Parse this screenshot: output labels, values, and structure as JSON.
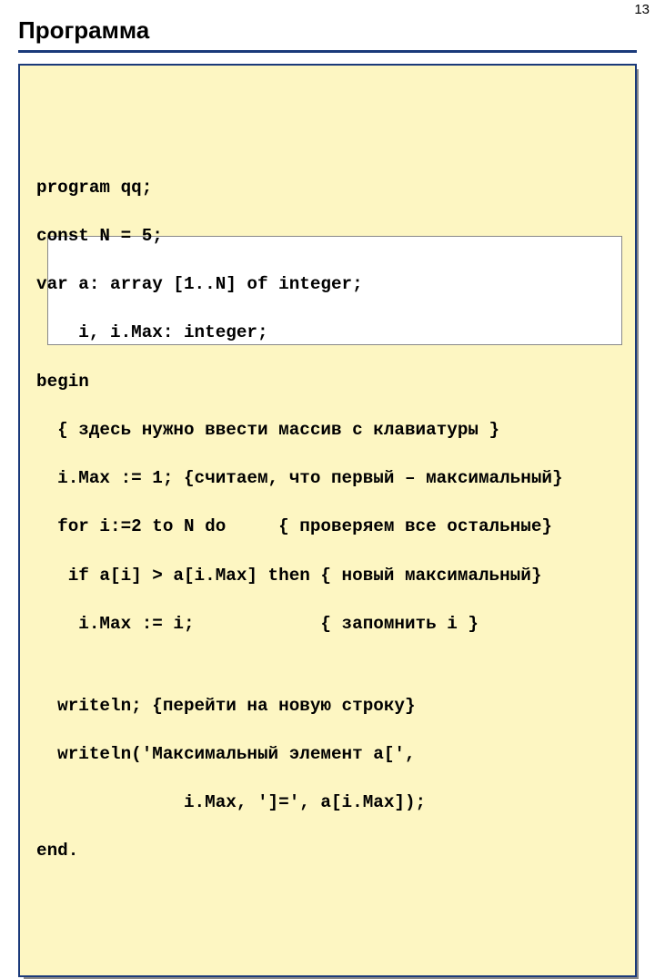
{
  "page_number": "13",
  "title": "Программа",
  "code": {
    "l1": "program qq;",
    "l2": "const N = 5;",
    "l3": "var a: array [1..N] of integer;",
    "l4": "    i, i.Max: integer;",
    "l5": "begin",
    "l6": "  { здесь нужно ввести массив с клавиатуры }",
    "l7": "  i.Max := 1; {считаем, что первый – максимальный}",
    "l8": "  for i:=2 to N do     { проверяем все остальные}",
    "l9": "   if a[i] > a[i.Max] then { новый максимальный}",
    "l10": "    i.Max := i;            { запомнить i }",
    "l11": "  writeln; {перейти на новую строку}",
    "l12": "  writeln('Максимальный элемент a[',",
    "l13": "              i.Max, ']=', a[i.Max]);",
    "l14": "end."
  }
}
